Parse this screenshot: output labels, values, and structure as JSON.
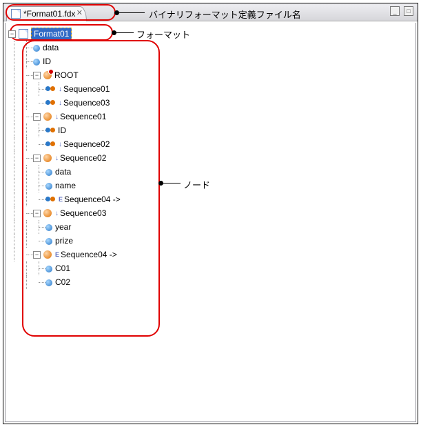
{
  "tab": {
    "title": "*Format01.fdx",
    "close_tooltip": "Close"
  },
  "window_buttons": {
    "minimize": "_",
    "maximize": "□"
  },
  "annotations": {
    "filename_label": "バイナリフォーマット定義ファイル名",
    "format_label": "フォーマット",
    "node_label": "ノード"
  },
  "tree": {
    "root": {
      "label": "Format01",
      "children": [
        {
          "icon": "attr",
          "label": "data"
        },
        {
          "icon": "attr",
          "label": "ID"
        },
        {
          "icon": "root",
          "label": "ROOT",
          "expanded": true,
          "children": [
            {
              "icon": "seqref",
              "label": "Sequence01"
            },
            {
              "icon": "seqref",
              "label": "Sequence03"
            }
          ]
        },
        {
          "icon": "seq",
          "label": "Sequence01",
          "expanded": true,
          "children": [
            {
              "icon": "seqref",
              "label": "ID"
            },
            {
              "icon": "seqref",
              "label": "Sequence02"
            }
          ]
        },
        {
          "icon": "seq",
          "label": "Sequence02",
          "expanded": true,
          "children": [
            {
              "icon": "attr",
              "label": "data"
            },
            {
              "icon": "attr",
              "label": "name"
            },
            {
              "icon": "seqE",
              "label": "Sequence04 ->"
            }
          ]
        },
        {
          "icon": "seq",
          "label": "Sequence03",
          "expanded": true,
          "children": [
            {
              "icon": "attr",
              "label": "year"
            },
            {
              "icon": "attr",
              "label": "prize"
            }
          ]
        },
        {
          "icon": "seqE",
          "label": "Sequence04 ->",
          "expanded": true,
          "children": [
            {
              "icon": "attr",
              "label": "C01"
            },
            {
              "icon": "attr",
              "label": "C02"
            }
          ]
        }
      ]
    }
  }
}
